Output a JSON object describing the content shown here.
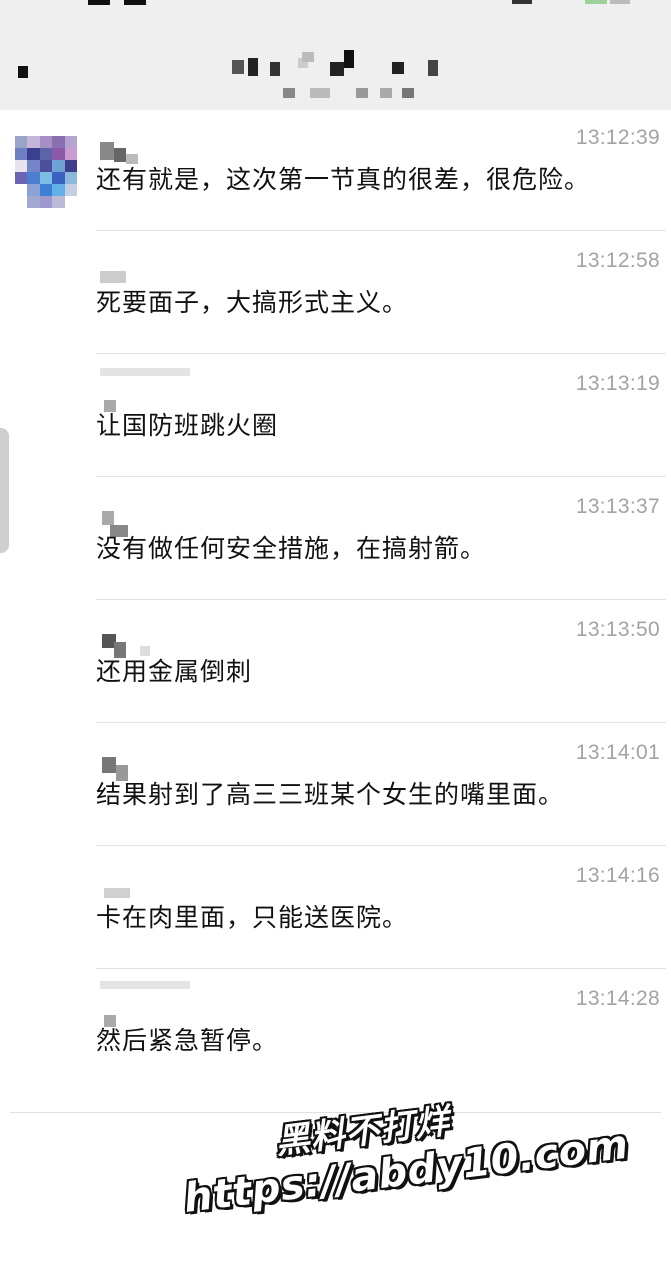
{
  "colors": {
    "header_bg": "#efefef",
    "timestamp": "#a3a3a3",
    "message_text": "#111111",
    "divider": "#e3e3e3",
    "watermark_fill": "#ffffff",
    "watermark_outline": "#111111"
  },
  "messages": [
    {
      "time": "13:12:39",
      "text": "还有就是，这次第一节真的很差，很危险。"
    },
    {
      "time": "13:12:58",
      "text": "死要面子，大搞形式主义。"
    },
    {
      "time": "13:13:19",
      "text": "让国防班跳火圈"
    },
    {
      "time": "13:13:37",
      "text": "没有做任何安全措施，在搞射箭。"
    },
    {
      "time": "13:13:50",
      "text": "还用金属倒刺"
    },
    {
      "time": "13:14:01",
      "text": "结果射到了高三三班某个女生的嘴里面。"
    },
    {
      "time": "13:14:16",
      "text": "卡在肉里面，只能送医院。"
    },
    {
      "time": "13:14:28",
      "text": "然后紧急暂停。"
    }
  ],
  "watermark": {
    "line1": "黑料不打烊",
    "line2": "https://abdy10.com"
  },
  "icons": {
    "back": "back-icon",
    "avatar": "avatar-mosaic"
  }
}
